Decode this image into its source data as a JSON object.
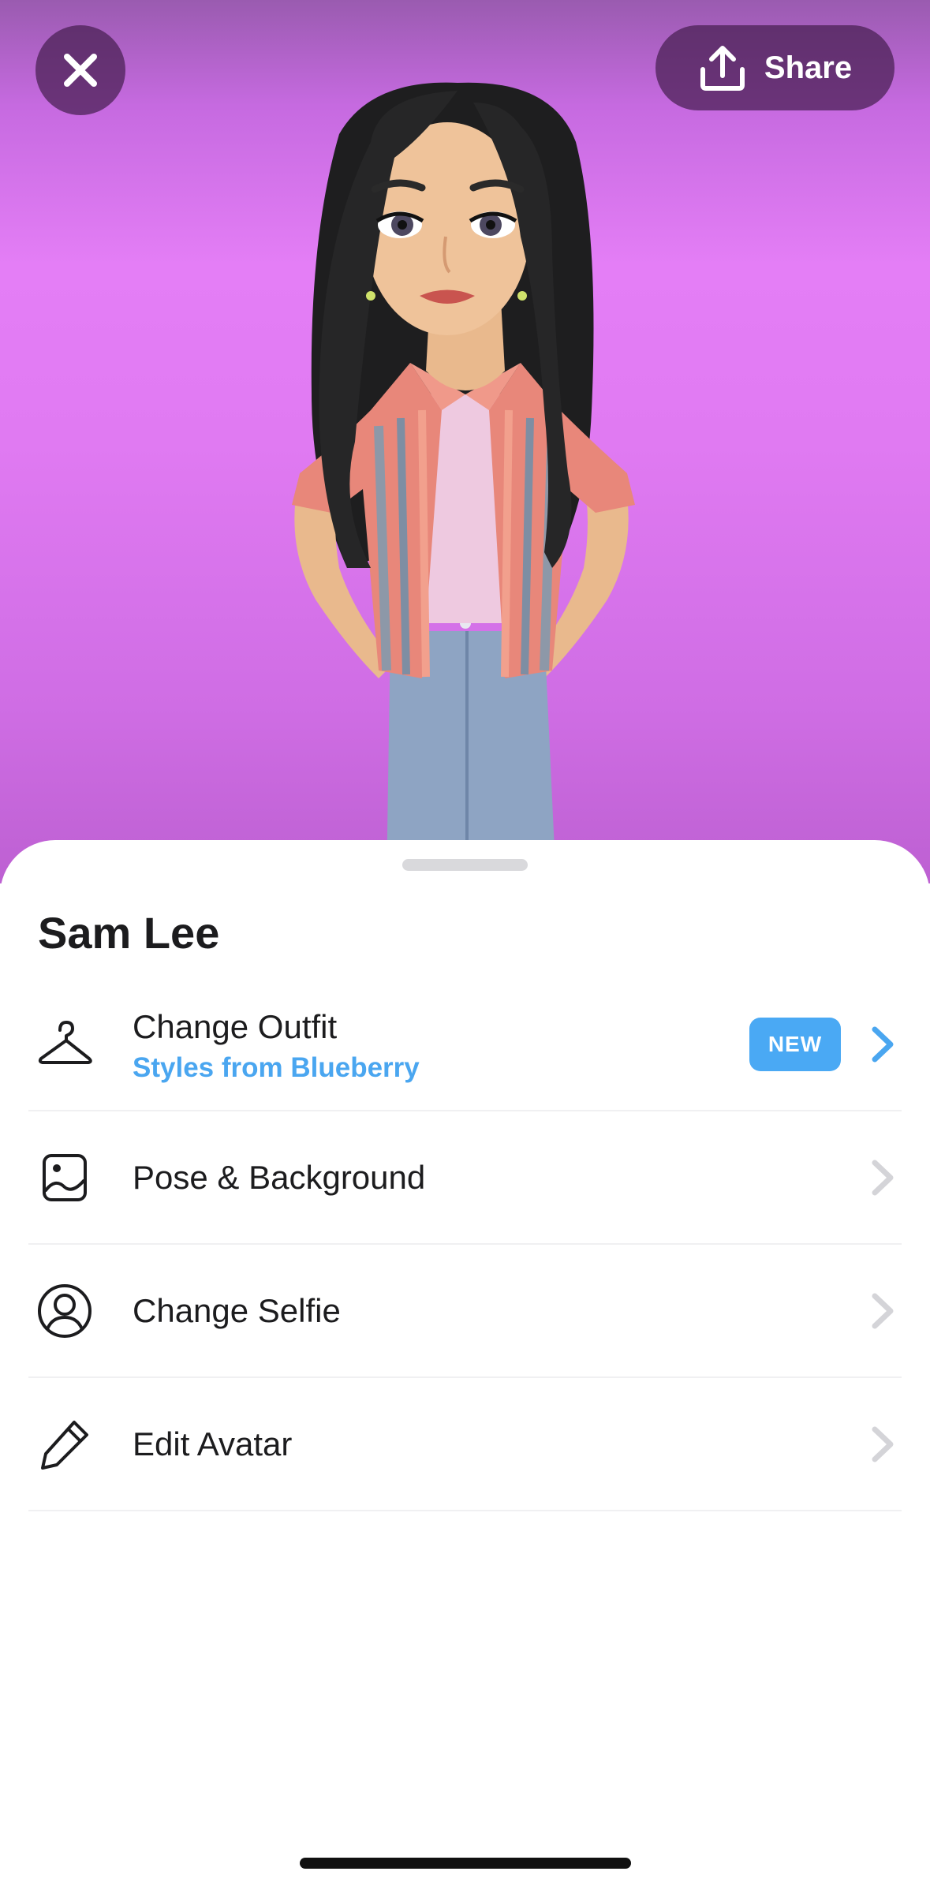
{
  "header": {
    "close_icon": "close-icon",
    "share_label": "Share",
    "share_icon": "upload-icon"
  },
  "sheet": {
    "title": "Sam Lee",
    "items": [
      {
        "label": "Change Outfit",
        "sublabel": "Styles from Blueberry",
        "badge": "NEW",
        "icon": "hanger-icon",
        "chevron_color": "#4aa6f0"
      },
      {
        "label": "Pose & Background",
        "icon": "photo-frame-icon",
        "chevron_color": "#d4d4d8"
      },
      {
        "label": "Change Selfie",
        "icon": "person-circle-icon",
        "chevron_color": "#d4d4d8"
      },
      {
        "label": "Edit Avatar",
        "icon": "pencil-icon",
        "chevron_color": "#d4d4d8"
      }
    ]
  },
  "colors": {
    "stage_background": "#e07af2",
    "accent": "#4aa6f0",
    "button_overlay": "#5a2a68"
  }
}
